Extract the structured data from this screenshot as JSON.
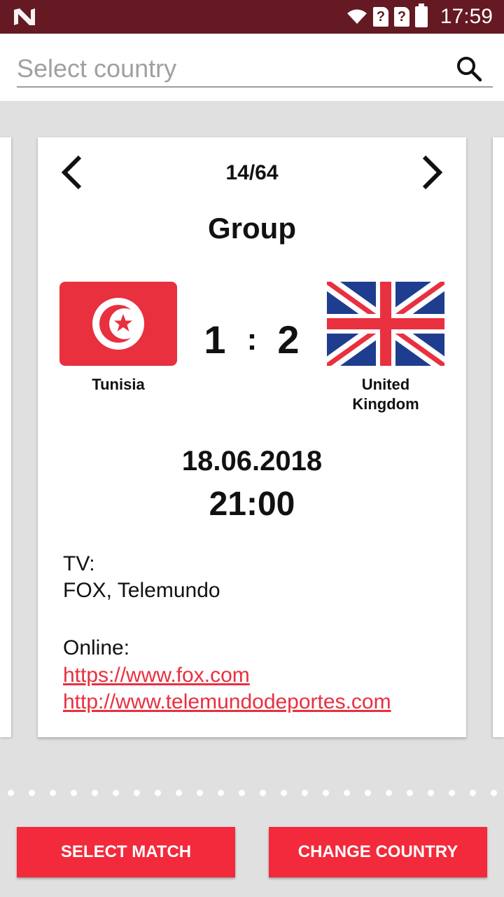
{
  "status_bar": {
    "time": "17:59",
    "sim1": "?",
    "sim2": "?"
  },
  "search": {
    "placeholder": "Select country"
  },
  "match": {
    "counter": "14/64",
    "stage": "Group",
    "home_team": "Tunisia",
    "away_team": "United Kingdom",
    "home_score": "1",
    "separator": ":",
    "away_score": "2",
    "date": "18.06.2018",
    "time": "21:00",
    "tv_label": "TV:",
    "tv_value": "FOX, Telemundo",
    "online_label": "Online:",
    "links": [
      "https://www.fox.com",
      "http://www.telemundodeportes.com"
    ]
  },
  "pager": {
    "dot_count": 24
  },
  "buttons": {
    "select_match": "SELECT MATCH",
    "change_country": "CHANGE COUNTRY"
  },
  "colors": {
    "status_bar": "#641923",
    "accent": "#f22a3b",
    "link": "#e8303f"
  }
}
